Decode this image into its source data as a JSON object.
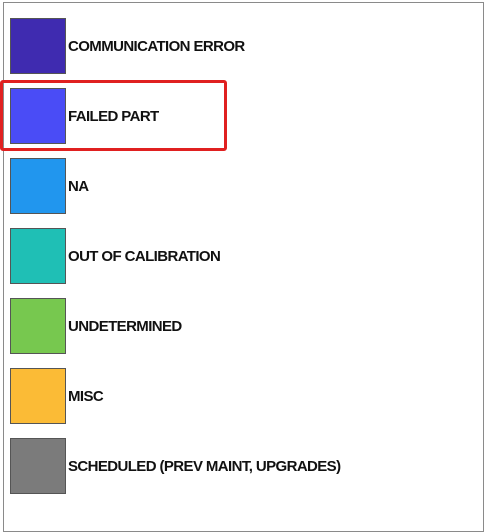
{
  "legend": {
    "items": [
      {
        "label": "COMMUNICATION ERROR",
        "color": "#3f2bb0"
      },
      {
        "label": "FAILED PART",
        "color": "#4a4cf6"
      },
      {
        "label": "NA",
        "color": "#2196ee"
      },
      {
        "label": "OUT OF CALIBRATION",
        "color": "#1fbfb5"
      },
      {
        "label": "UNDETERMINED",
        "color": "#77c84f"
      },
      {
        "label": "MISC",
        "color": "#fbbb36"
      },
      {
        "label": "SCHEDULED (PREV MAINT, UPGRADES)",
        "color": "#7b7b7b"
      }
    ],
    "highlighted_item": "FAILED PART",
    "highlight_color": "#e02020"
  }
}
